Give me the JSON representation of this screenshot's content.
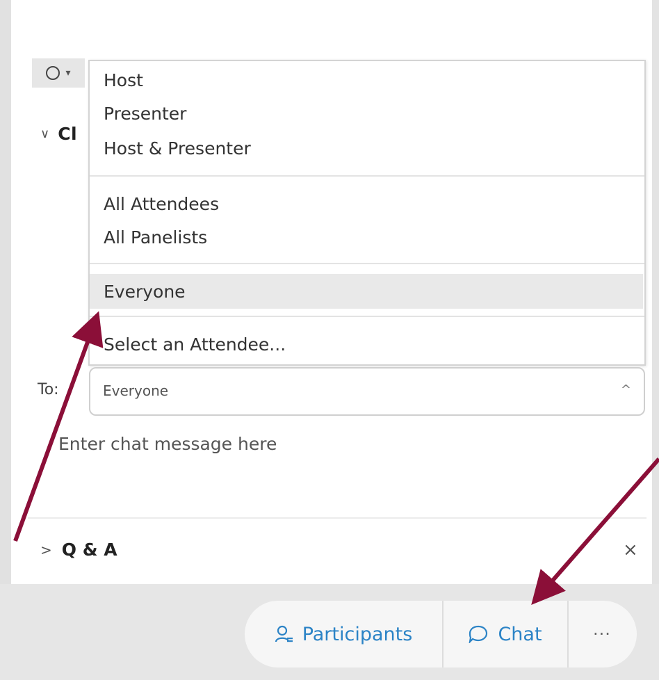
{
  "chat_panel": {
    "section_title": "Cl",
    "toolbar_caret": "▾"
  },
  "dropdown": {
    "items": [
      {
        "label": "Host"
      },
      {
        "label": "Presenter"
      },
      {
        "label": "Host & Presenter"
      },
      {
        "label": "All Attendees"
      },
      {
        "label": "All Panelists"
      },
      {
        "label": "Everyone",
        "selected": true
      },
      {
        "label": "Select an Attendee..."
      }
    ]
  },
  "to_field": {
    "label": "To:",
    "value": "Everyone"
  },
  "message_input": {
    "placeholder": "Enter chat message here"
  },
  "qa_section": {
    "title": "Q & A",
    "close_glyph": "×"
  },
  "bottom_bar": {
    "participants_label": "Participants",
    "chat_label": "Chat",
    "more_label": "···"
  },
  "colors": {
    "accent_blue": "#2b83c6",
    "arrow_maroon": "#8b0f38",
    "highlight_gray": "#e9e9e9"
  }
}
